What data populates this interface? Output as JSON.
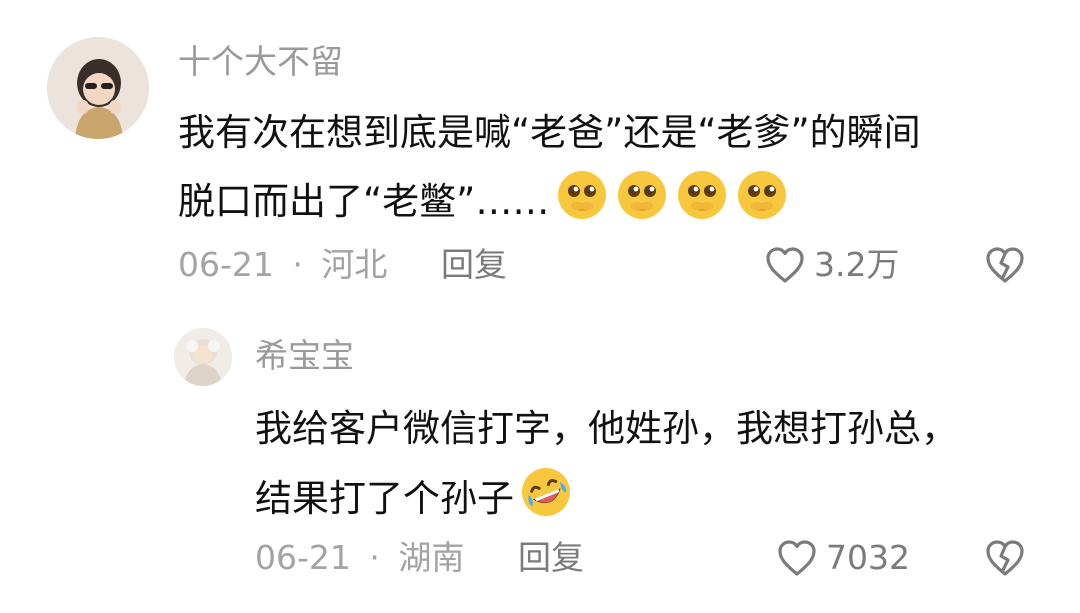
{
  "comments": [
    {
      "username": "十个大不留",
      "content_line1": "我有次在想到底是喊“老爸”还是“老爹”的瞬间",
      "content_line2": "脱口而出了“老鳖”……",
      "emoji_icon": "pleading-face-icon",
      "date": "06-21",
      "separator": "·",
      "location": "河北",
      "reply_label": "回复",
      "likes": "3.2万"
    },
    {
      "username": "希宝宝",
      "content_line1": "我给客户微信打字，他姓孙，我想打孙总，",
      "content_line2": "结果打了个孙子",
      "emoji_icon": "rolling-laughing-icon",
      "date": "06-21",
      "separator": "·",
      "location": "湖南",
      "reply_label": "回复",
      "likes": "7032"
    }
  ],
  "icons": {
    "like": "heart-outline-icon",
    "dislike": "broken-heart-outline-icon"
  },
  "colors": {
    "text": "#111111",
    "username": "#9a9a9a",
    "meta": "#a3a3a3",
    "action": "#7b7b7b",
    "emoji": "#f7c73d"
  }
}
